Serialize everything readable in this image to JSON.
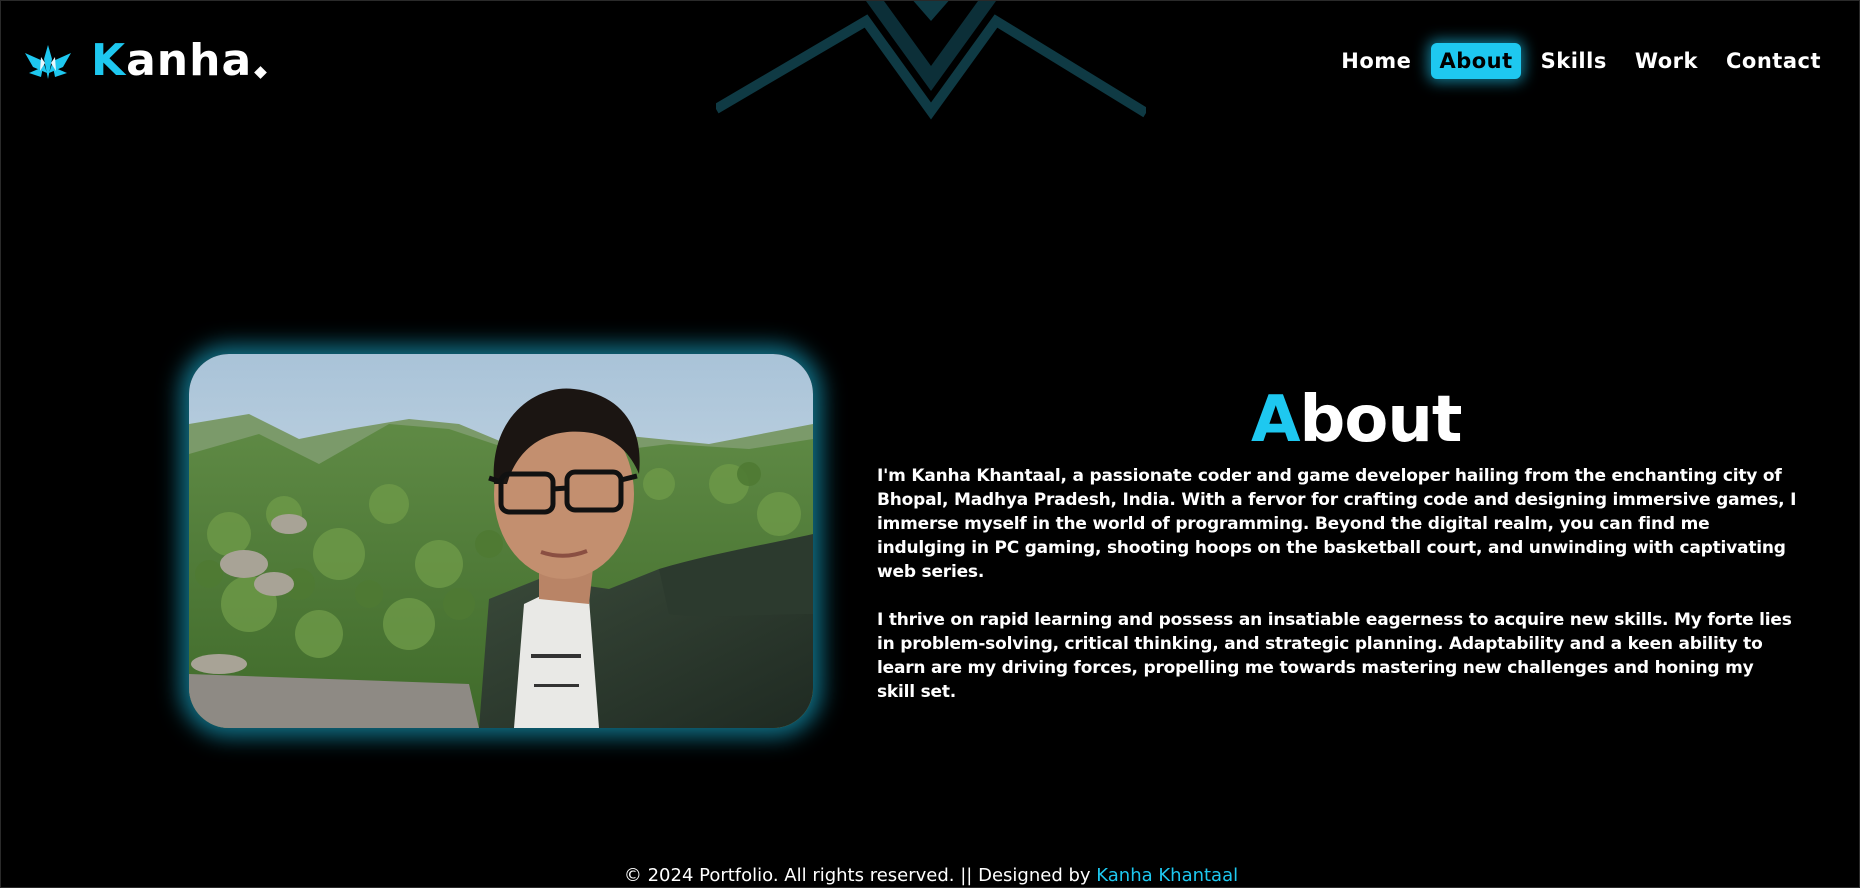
{
  "brand": {
    "logo_first_letter": "K",
    "logo_rest": "anha",
    "logo_icon": "spiky-emblem-icon"
  },
  "nav": {
    "items": [
      {
        "label": "Home",
        "active": false
      },
      {
        "label": "About",
        "active": true
      },
      {
        "label": "Skills",
        "active": false
      },
      {
        "label": "Work",
        "active": false
      },
      {
        "label": "Contact",
        "active": false
      }
    ]
  },
  "about": {
    "title_first_letter": "A",
    "title_rest": "bout",
    "paragraphs": [
      "I'm Kanha Khantaal, a passionate coder and game developer hailing from the enchanting city of Bhopal, Madhya Pradesh, India. With a fervor for crafting code and designing immersive games, I immerse myself in the world of programming. Beyond the digital realm, you can find me indulging in PC gaming, shooting hoops on the basketball court, and unwinding with captivating web series.",
      "I thrive on rapid learning and possess an insatiable eagerness to acquire new skills. My forte lies in problem-solving, critical thinking, and strategic planning. Adaptability and a keen ability to learn are my driving forces, propelling me towards mastering new challenges and honing my skill set."
    ],
    "photo": "profile-photo-selfie-hills"
  },
  "footer": {
    "text": "© 2024 Portfolio. All rights reserved. || Designed by ",
    "author": "Kanha Khantaal"
  },
  "colors": {
    "accent": "#1ec8f0",
    "background": "#000000",
    "text": "#ffffff"
  }
}
